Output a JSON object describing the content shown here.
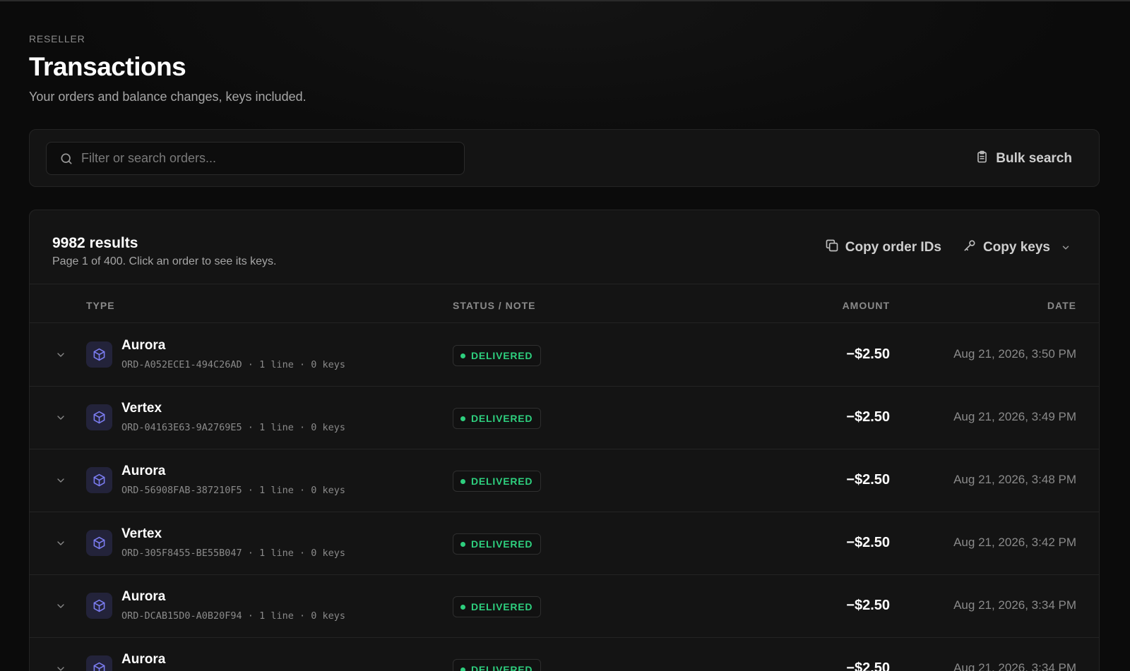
{
  "header": {
    "eyebrow": "RESELLER",
    "title": "Transactions",
    "subtitle": "Your orders and balance changes, keys included."
  },
  "search": {
    "placeholder": "Filter or search orders...",
    "value": "",
    "bulk_label": "Bulk search"
  },
  "results": {
    "count": "9982 results",
    "page_info": "Page 1 of 400. Click an order to see its keys.",
    "copy_ids_label": "Copy order IDs",
    "copy_keys_label": "Copy keys"
  },
  "table": {
    "columns": {
      "type": "TYPE",
      "status": "STATUS / NOTE",
      "amount": "AMOUNT",
      "date": "DATE"
    },
    "rows": [
      {
        "name": "Aurora",
        "meta": "ORD-A052ECE1-494C26AD · 1 line · 0 keys",
        "status": "DELIVERED",
        "amount": "−$2.50",
        "date": "Aug 21, 2026, 3:50 PM"
      },
      {
        "name": "Vertex",
        "meta": "ORD-04163E63-9A2769E5 · 1 line · 0 keys",
        "status": "DELIVERED",
        "amount": "−$2.50",
        "date": "Aug 21, 2026, 3:49 PM"
      },
      {
        "name": "Aurora",
        "meta": "ORD-56908FAB-387210F5 · 1 line · 0 keys",
        "status": "DELIVERED",
        "amount": "−$2.50",
        "date": "Aug 21, 2026, 3:48 PM"
      },
      {
        "name": "Vertex",
        "meta": "ORD-305F8455-BE55B047 · 1 line · 0 keys",
        "status": "DELIVERED",
        "amount": "−$2.50",
        "date": "Aug 21, 2026, 3:42 PM"
      },
      {
        "name": "Aurora",
        "meta": "ORD-DCAB15D0-A0B20F94 · 1 line · 0 keys",
        "status": "DELIVERED",
        "amount": "−$2.50",
        "date": "Aug 21, 2026, 3:34 PM"
      },
      {
        "name": "Aurora",
        "meta": "",
        "status": "DELIVERED",
        "amount": "−$2.50",
        "date": "Aug 21, 2026, 3:34 PM"
      }
    ]
  },
  "icons": {
    "search": "search-icon",
    "bulk": "clipboard-icon",
    "copy": "copy-icon",
    "key": "key-icon",
    "chevron": "chevron-down-icon",
    "product": "package-icon"
  },
  "colors": {
    "background": "#0b0b0b",
    "panel": "#141414",
    "border": "#242424",
    "status_delivered": "#2ecf7e",
    "product_icon_bg": "#23233a",
    "product_icon_fg": "#7b7cf0"
  }
}
